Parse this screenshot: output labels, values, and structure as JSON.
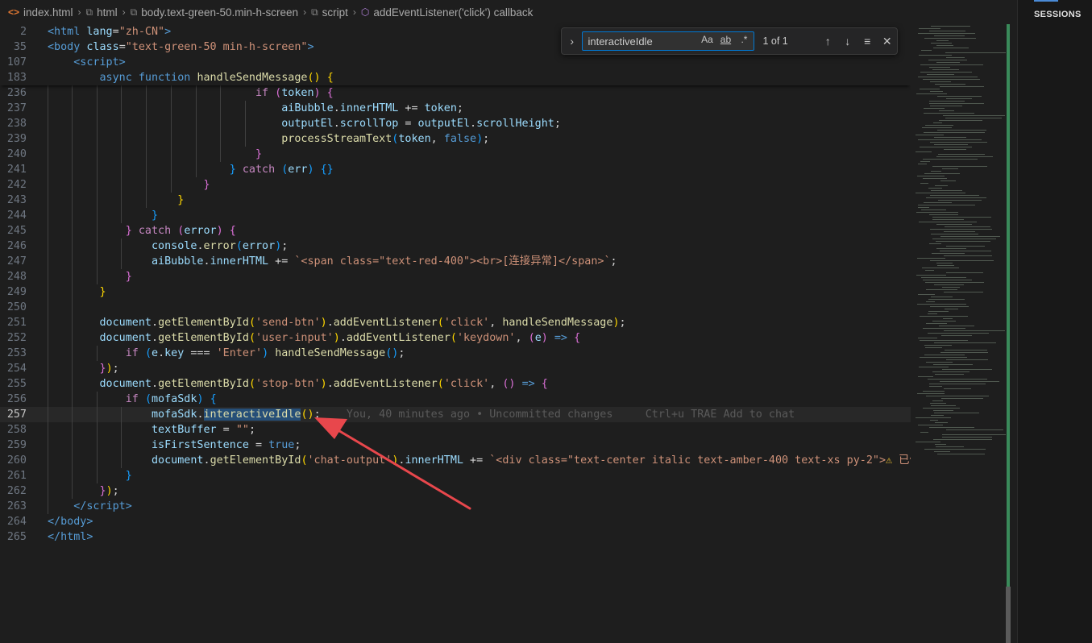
{
  "breadcrumb": [
    {
      "icon": "html-file-icon",
      "label": "index.html"
    },
    {
      "icon": "tag-icon",
      "label": "html"
    },
    {
      "icon": "tag-icon",
      "label": "body.text-green-50.min-h-screen"
    },
    {
      "icon": "tag-icon",
      "label": "script"
    },
    {
      "icon": "cube-icon",
      "label": "addEventListener('click') callback"
    }
  ],
  "find": {
    "query": "interactiveIdle",
    "match_case": "Aa",
    "whole_word": "ab",
    "regex": ".*",
    "count": "1 of 1"
  },
  "sessions": {
    "title": "SESSIONS"
  },
  "editor": {
    "blame": "You, 40 minutes ago • Uncommitted changes",
    "hint": "Ctrl+u TRAE Add to chat",
    "current_line": "257",
    "line_numbers": [
      "2",
      "35",
      "107",
      "183",
      "236",
      "237",
      "238",
      "239",
      "240",
      "241",
      "242",
      "243",
      "244",
      "245",
      "246",
      "247",
      "248",
      "249",
      "250",
      "251",
      "252",
      "253",
      "254",
      "255",
      "256",
      "257",
      "258",
      "259",
      "260",
      "261",
      "262",
      "263",
      "264",
      "265"
    ]
  },
  "colors": {
    "accent": "#0078d4",
    "git_added": "#3a8a5a",
    "arrow": "#e8474c"
  }
}
